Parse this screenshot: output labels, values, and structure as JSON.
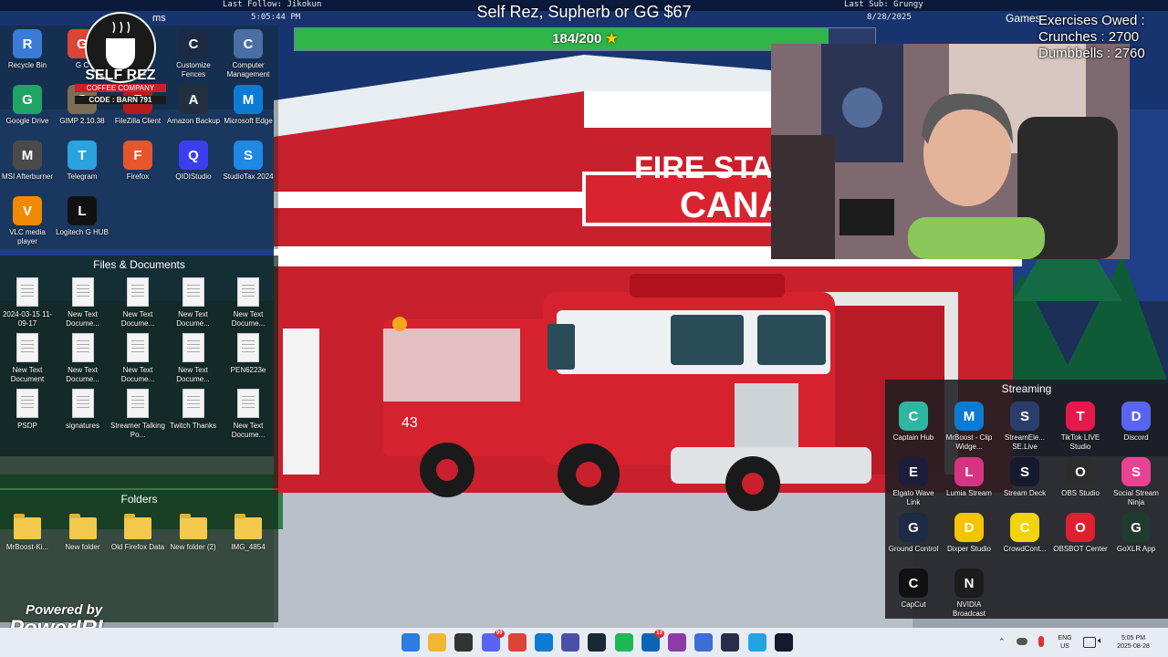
{
  "overlay": {
    "last_follow": "Last Follow: Jikokun",
    "clock": "5:05:44 PM",
    "last_sub": "Last Sub: Grungy",
    "date": "8/28/2025",
    "goal_title": "Self Rez, Supherb or GG $67",
    "goal_progress_text": "184/200",
    "goal_progress_fraction": 0.92,
    "exercises_owed": "Exercises Owed :",
    "crunches": "Crunches : 2700",
    "dumbbells": "Dumbbells : 2760",
    "partial_fence_title_left": "ms",
    "partial_fence_title_right": "Games"
  },
  "wallpaper": {
    "sign_line1": "FIRE STA",
    "sign_line2": "CANA",
    "truck_door_number": "43"
  },
  "logos": {
    "self_rez_name": "SELF REZ",
    "self_rez_sub": "COFFEE COMPANY",
    "self_rez_code": "CODE : BARN 791",
    "powered_by": "Powered by",
    "powerirl": "PowerIRL"
  },
  "desktop_top": [
    {
      "label": "Recycle Bin",
      "icon": "recycle-bin-icon",
      "color": "#3a7bd5"
    },
    {
      "label": "G C",
      "icon": "chrome-icon",
      "color": "#db4437"
    },
    {
      "label": "Customize Fences",
      "icon": "fences-icon",
      "color": "#1c2a44"
    },
    {
      "label": "Computer Management",
      "icon": "computer-management-icon",
      "color": "#4a6fa5"
    },
    {
      "label": "Google Drive",
      "icon": "google-drive-icon",
      "color": "#1fa463"
    },
    {
      "label": "GIMP 2.10.38",
      "icon": "gimp-icon",
      "color": "#7b6c55"
    },
    {
      "label": "FileZilla Client",
      "icon": "filezilla-icon",
      "color": "#b71c1c"
    },
    {
      "label": "Amazon Backup",
      "icon": "amazon-photos-icon",
      "color": "#232f3e"
    },
    {
      "label": "Microsoft Edge",
      "icon": "edge-icon",
      "color": "#0c7bd3"
    },
    {
      "label": "MSI Afterburner",
      "icon": "msi-afterburner-icon",
      "color": "#4a4a4a"
    },
    {
      "label": "Telegram",
      "icon": "telegram-icon",
      "color": "#2aa3df"
    },
    {
      "label": "Firefox",
      "icon": "firefox-icon",
      "color": "#e8552d"
    },
    {
      "label": "QIDIStudio",
      "icon": "qidistudio-icon",
      "color": "#3d3df0"
    },
    {
      "label": "StudioTax 2024",
      "icon": "studiotax-icon",
      "color": "#1e88e5"
    },
    {
      "label": "VLC media player",
      "icon": "vlc-icon",
      "color": "#f08a00"
    },
    {
      "label": "Logitech G HUB",
      "icon": "logitech-g-hub-icon",
      "color": "#111111"
    }
  ],
  "files_fence": {
    "title": "Files & Documents",
    "items": [
      {
        "label": "2024-03-15 11-09-17"
      },
      {
        "label": "New Text Docume..."
      },
      {
        "label": "New Text Docume..."
      },
      {
        "label": "New Text Docume..."
      },
      {
        "label": "New Text Docume..."
      },
      {
        "label": "New Text Document"
      },
      {
        "label": "New Text Docume..."
      },
      {
        "label": "New Text Docume..."
      },
      {
        "label": "New Text Docume..."
      },
      {
        "label": "PEN6223e"
      },
      {
        "label": "PSDP"
      },
      {
        "label": "signatures"
      },
      {
        "label": "Streamer Talking Po..."
      },
      {
        "label": "Twitch Thanks"
      },
      {
        "label": "New Text Docume..."
      }
    ]
  },
  "folders_fence": {
    "title": "Folders",
    "items": [
      {
        "label": "MrBoost-Ki..."
      },
      {
        "label": "New folder"
      },
      {
        "label": "Old Firefox Data"
      },
      {
        "label": "New folder (2)"
      },
      {
        "label": "IMG_4854"
      }
    ]
  },
  "streaming_fence": {
    "title": "Streaming",
    "items": [
      {
        "label": "Captain Hub",
        "icon": "captain-hub-icon",
        "color": "#2fb6a0"
      },
      {
        "label": "MrBoost - Clip Widge...",
        "icon": "edge-icon",
        "color": "#0c7bd3"
      },
      {
        "label": "StreamEle... SE.Live",
        "icon": "streamelements-icon",
        "color": "#2b3e6b"
      },
      {
        "label": "TikTok LIVE Studio",
        "icon": "tiktok-icon",
        "color": "#e5194b"
      },
      {
        "label": "Discord",
        "icon": "discord-icon",
        "color": "#5865f2"
      },
      {
        "label": "Elgato Wave Link",
        "icon": "wave-link-icon",
        "color": "#1d1d3b"
      },
      {
        "label": "Lumia Stream",
        "icon": "lumia-stream-icon",
        "color": "#d63384"
      },
      {
        "label": "Stream Deck",
        "icon": "stream-deck-icon",
        "color": "#151a2e"
      },
      {
        "label": "OBS Studio",
        "icon": "obs-icon",
        "color": "#2d2d2d"
      },
      {
        "label": "Social Stream Ninja",
        "icon": "social-stream-ninja-icon",
        "color": "#e84393"
      },
      {
        "label": "Ground Control",
        "icon": "ground-control-icon",
        "color": "#1f2a44"
      },
      {
        "label": "Dixper Studio",
        "icon": "dixper-icon",
        "color": "#f5c400"
      },
      {
        "label": "CrowdCont...",
        "icon": "crowd-control-icon",
        "color": "#f2d40a"
      },
      {
        "label": "OBSBOT Center",
        "icon": "obsbot-icon",
        "color": "#e02030"
      },
      {
        "label": "GoXLR App",
        "icon": "goxlr-icon",
        "color": "#1f3b2e"
      },
      {
        "label": "CapCut",
        "icon": "capcut-icon",
        "color": "#111111"
      },
      {
        "label": "NVIDIA Broadcast",
        "icon": "nvidia-broadcast-icon",
        "color": "#1c1c1c"
      }
    ]
  },
  "taskbar": {
    "icons": [
      {
        "name": "windows-start-icon",
        "color": "#2a7de1"
      },
      {
        "name": "file-explorer-icon",
        "color": "#f2b632"
      },
      {
        "name": "microsoft-store-icon",
        "color": "#333333"
      },
      {
        "name": "discord-taskbar-icon",
        "color": "#5865f2",
        "badge": "99"
      },
      {
        "name": "chrome-taskbar-icon",
        "color": "#db4437"
      },
      {
        "name": "edge-taskbar-icon",
        "color": "#0c7bd3"
      },
      {
        "name": "mixitup-taskbar-icon",
        "color": "#4b4fa8"
      },
      {
        "name": "steam-taskbar-icon",
        "color": "#1b2838"
      },
      {
        "name": "spotify-taskbar-icon",
        "color": "#1db954"
      },
      {
        "name": "outlook-taskbar-icon",
        "color": "#0a64b8",
        "badge": "13"
      },
      {
        "name": "streamer-bot-taskbar-icon",
        "color": "#8e3aa8"
      },
      {
        "name": "photos-taskbar-icon",
        "color": "#3b6fd6"
      },
      {
        "name": "arrow-app-taskbar-icon",
        "color": "#2b2b4a"
      },
      {
        "name": "vscode-taskbar-icon",
        "color": "#23a3e3"
      },
      {
        "name": "stream-deck-taskbar-icon",
        "color": "#15192e"
      }
    ],
    "language": "ENG",
    "region": "US",
    "time": "5:05 PM",
    "date": "2025-08-28"
  }
}
